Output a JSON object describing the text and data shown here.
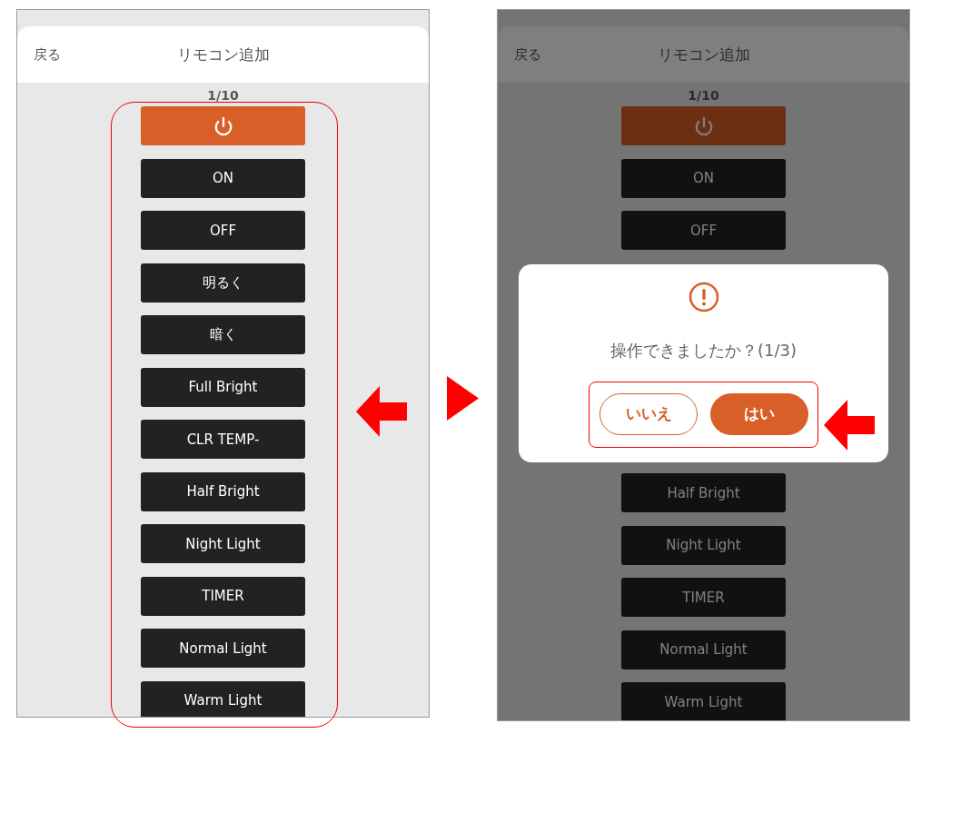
{
  "screens": [
    {
      "dimmed": false,
      "header": {
        "back": "戻る",
        "title": "リモコン追加"
      },
      "counter": "1/10",
      "buttons": [
        {
          "kind": "power"
        },
        {
          "kind": "text",
          "label": "ON"
        },
        {
          "kind": "text",
          "label": "OFF"
        },
        {
          "kind": "text",
          "label": "明るく"
        },
        {
          "kind": "text",
          "label": "暗く"
        },
        {
          "kind": "text",
          "label": "Full Bright"
        },
        {
          "kind": "text",
          "label": "CLR TEMP-"
        },
        {
          "kind": "text",
          "label": "Half Bright"
        },
        {
          "kind": "text",
          "label": "Night Light"
        },
        {
          "kind": "text",
          "label": "TIMER"
        },
        {
          "kind": "text",
          "label": "Normal Light"
        },
        {
          "kind": "text",
          "label": "Warm Light"
        }
      ]
    },
    {
      "dimmed": true,
      "header": {
        "back": "戻る",
        "title": "リモコン追加"
      },
      "counter": "1/10",
      "buttons": [
        {
          "kind": "power"
        },
        {
          "kind": "text",
          "label": "ON"
        },
        {
          "kind": "text",
          "label": "OFF"
        }
      ],
      "dialog": {
        "message": "操作できましたか？(1/3)",
        "buttons": [
          {
            "kind": "outline",
            "label": "いいえ"
          },
          {
            "kind": "filled",
            "label": "はい"
          }
        ]
      },
      "buttons_after_dialog": [
        {
          "kind": "text",
          "label": "Half Bright"
        },
        {
          "kind": "text",
          "label": "Night Light"
        },
        {
          "kind": "text",
          "label": "TIMER"
        },
        {
          "kind": "text",
          "label": "Normal Light"
        },
        {
          "kind": "text",
          "label": "Warm Light"
        }
      ]
    }
  ]
}
